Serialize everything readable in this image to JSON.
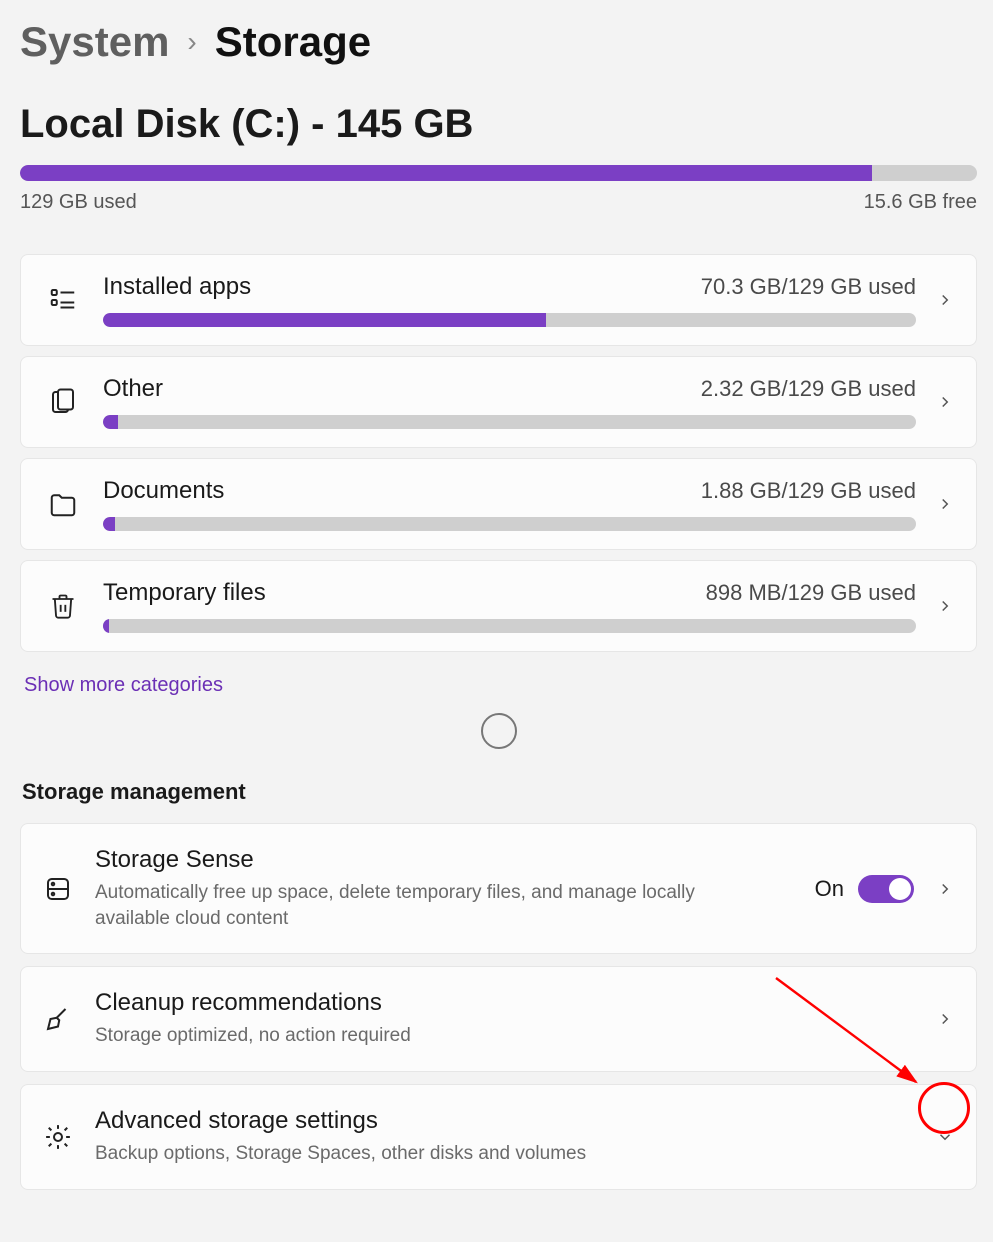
{
  "colors": {
    "accent": "#7b3fc4"
  },
  "breadcrumb": {
    "parent": "System",
    "current": "Storage"
  },
  "disk": {
    "title": "Local Disk (C:) - 145 GB",
    "used_label": "129 GB used",
    "free_label": "15.6 GB free",
    "used_pct": 89
  },
  "categories": [
    {
      "icon": "apps",
      "title": "Installed apps",
      "usage": "70.3 GB/129 GB used",
      "pct": 54.5
    },
    {
      "icon": "other",
      "title": "Other",
      "usage": "2.32 GB/129 GB used",
      "pct": 1.8
    },
    {
      "icon": "documents",
      "title": "Documents",
      "usage": "1.88 GB/129 GB used",
      "pct": 1.5
    },
    {
      "icon": "trash",
      "title": "Temporary files",
      "usage": "898 MB/129 GB used",
      "pct": 0.7
    }
  ],
  "show_more": "Show more categories",
  "storage_mgmt_heading": "Storage management",
  "storage_sense": {
    "icon": "drive",
    "title": "Storage Sense",
    "desc": "Automatically free up space, delete temporary files, and manage locally available cloud content",
    "state_label": "On",
    "on": true
  },
  "cleanup": {
    "icon": "broom",
    "title": "Cleanup recommendations",
    "desc": "Storage optimized, no action required"
  },
  "advanced": {
    "icon": "gear",
    "title": "Advanced storage settings",
    "desc": "Backup options, Storage Spaces, other disks and volumes"
  }
}
